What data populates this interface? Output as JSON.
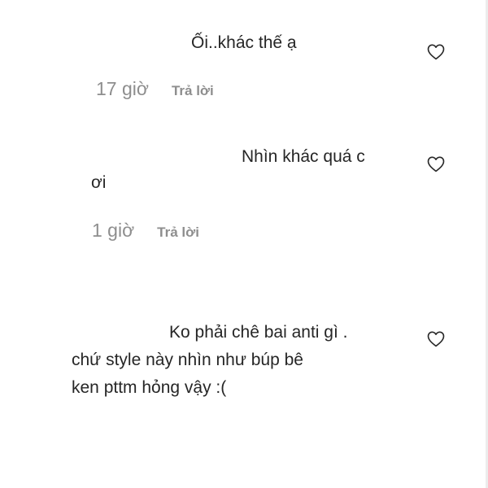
{
  "comments": [
    {
      "text": "Ối..khác thế ạ",
      "time": "17 giờ",
      "reply_label": "Trả lời",
      "like_icon": "heart-outline-icon"
    },
    {
      "text_line1": "Nhìn khác quá c",
      "text_line2": "ơi",
      "time": "1 giờ",
      "reply_label": "Trả lời",
      "like_icon": "heart-outline-icon"
    },
    {
      "text_line1": "Ko phải chê bai anti gì .",
      "text_line2": "chứ style này nhìn như búp bê",
      "text_line3": "ken pttm hỏng vậy :(",
      "like_icon": "heart-outline-icon"
    }
  ],
  "colors": {
    "text": "#262626",
    "meta": "#8e8e8e",
    "icon_stroke": "#262626"
  }
}
